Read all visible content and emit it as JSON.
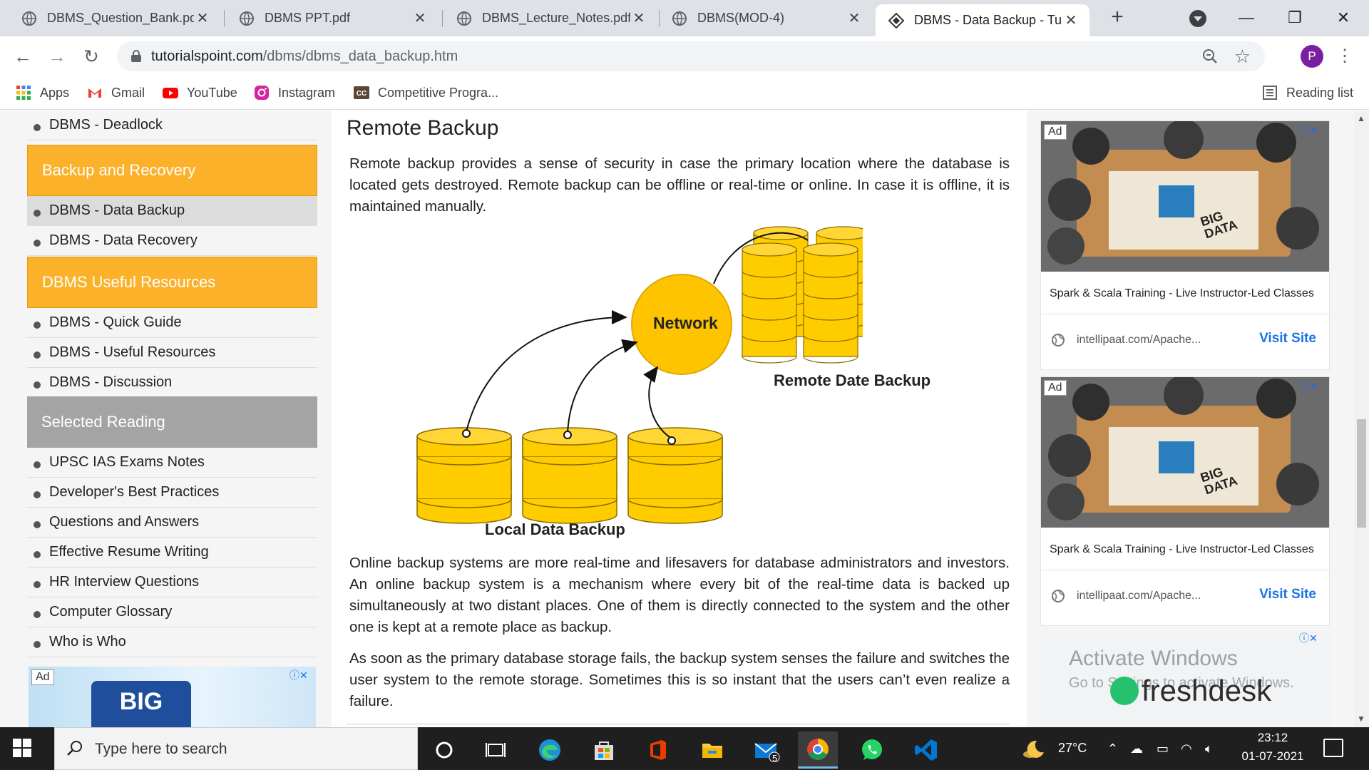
{
  "browser": {
    "tabs": [
      {
        "title": "DBMS_Question_Bank.pdf",
        "active": false
      },
      {
        "title": "DBMS PPT.pdf",
        "active": false
      },
      {
        "title": "DBMS_Lecture_Notes.pdf",
        "active": false
      },
      {
        "title": "DBMS(MOD-4)",
        "active": false
      },
      {
        "title": "DBMS - Data Backup - Tu",
        "active": true
      }
    ],
    "url_host": "tutorialspoint.com",
    "url_path": "/dbms/dbms_data_backup.htm",
    "profile_initial": "P",
    "bookmarks": [
      "Apps",
      "Gmail",
      "YouTube",
      "Instagram",
      "Competitive Progra..."
    ],
    "reading_list": "Reading list"
  },
  "sidebar": {
    "items_top": [
      "DBMS - Deadlock"
    ],
    "heading_backup": "Backup and Recovery",
    "items_backup": [
      "DBMS - Data Backup",
      "DBMS - Data Recovery"
    ],
    "selected": "DBMS - Data Backup",
    "heading_resources": "DBMS Useful Resources",
    "items_resources": [
      "DBMS - Quick Guide",
      "DBMS - Useful Resources",
      "DBMS - Discussion"
    ],
    "heading_reading": "Selected Reading",
    "items_reading": [
      "UPSC IAS Exams Notes",
      "Developer's Best Practices",
      "Questions and Answers",
      "Effective Resume Writing",
      "HR Interview Questions",
      "Computer Glossary",
      "Who is Who"
    ],
    "ad_label": "Ad",
    "ad_logo": "BIG"
  },
  "article": {
    "heading": "Remote Backup",
    "para1": "Remote backup provides a sense of security in case the primary location where the database is located gets destroyed. Remote backup can be offline or real-time or online. In case it is offline, it is maintained manually.",
    "diagram": {
      "network_label": "Network",
      "remote_label": "Remote Date Backup",
      "local_label": "Local Data Backup"
    },
    "para2": "Online backup systems are more real-time and lifesavers for database administrators and investors. An online backup system is a mechanism where every bit of the real-time data is backed up simultaneously at two distant places. One of them is directly connected to the system and the other one is kept at a remote place as backup.",
    "para3": "As soon as the primary database storage fails, the backup system senses the failure and switches the user system to the remote storage. Sometimes this is so instant that the users can’t even realize a failure."
  },
  "ads": [
    {
      "label": "Ad",
      "text": "Spark & Scala Training - Live Instructor-Led Classes",
      "host": "intellipaat.com/Apache...",
      "cta": "Visit Site",
      "image_text": "BIG DATA"
    },
    {
      "label": "Ad",
      "text": "Spark & Scala Training - Live Instructor-Led Classes",
      "host": "intellipaat.com/Apache...",
      "cta": "Visit Site",
      "image_text": "BIG DATA"
    }
  ],
  "windows_watermark": {
    "title": "Activate Windows",
    "subtitle": "Go to Settings to activate Windows."
  },
  "freshdesk_text": "freshdesk",
  "taskbar": {
    "search_placeholder": "Type here to search",
    "mail_badge": "5",
    "weather": "27°C",
    "time": "23:12",
    "date": "01-07-2021"
  },
  "colors": {
    "accent_orange": "#fbb12a",
    "heading_grey": "#a4a4a4",
    "db_yellow": "#ffcc00",
    "link_blue": "#1a73e8"
  }
}
